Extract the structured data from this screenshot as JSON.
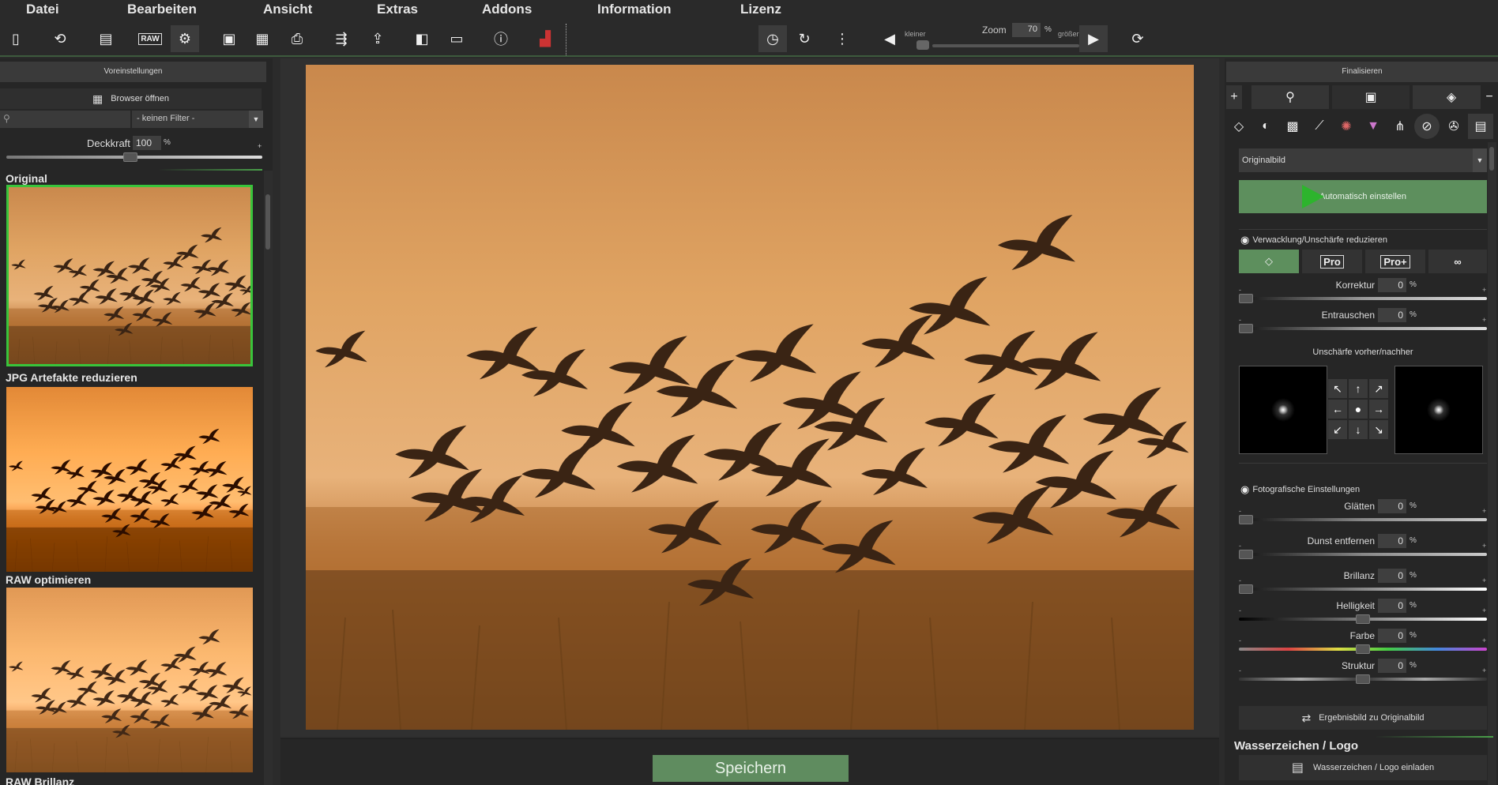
{
  "menu": [
    "Datei",
    "Bearbeiten",
    "Ansicht",
    "Extras",
    "Addons",
    "Information",
    "Lizenz"
  ],
  "toolbar": {
    "raw_label": "RAW",
    "zoom_label": "Zoom",
    "zoom_value": "70",
    "zoom_unit": "%",
    "zoom_smaller": "kleiner",
    "zoom_bigger": "größer",
    "zoom_level": 0.7
  },
  "left": {
    "header": "Voreinstellungen",
    "browser_button": "Browser öffnen",
    "filter_value": "- keinen Filter -",
    "opacity_label": "Deckkraft",
    "opacity_value": "100",
    "opacity_unit": "%",
    "opacity_plus": "+",
    "presets": [
      {
        "title": "Original",
        "selected": true
      },
      {
        "title": "JPG Artefakte reduzieren",
        "selected": false
      },
      {
        "title": "RAW optimieren",
        "selected": false
      },
      {
        "title": "RAW Brillanz",
        "selected": false
      }
    ]
  },
  "center": {
    "save_button": "Speichern"
  },
  "right": {
    "header": "Finalisieren",
    "tab_plus": "+",
    "tab_minus": "−",
    "source_select": "Originalbild",
    "auto_button": "Automatisch einstellen",
    "blur_section": "Verwacklung/Unschärfe reduzieren",
    "modes": [
      "",
      "Pro",
      "Pro+",
      ""
    ],
    "sliders_blur": [
      {
        "label": "Korrektur",
        "value": "0",
        "unit": "%"
      },
      {
        "label": "Entrauschen",
        "value": "0",
        "unit": "%"
      }
    ],
    "blur_preview_label": "Unschärfe vorher/nachher",
    "photo_section": "Fotografische Einstellungen",
    "sliders_photo": [
      {
        "label": "Glätten",
        "value": "0",
        "unit": "%"
      },
      {
        "label": "Dunst entfernen",
        "value": "0",
        "unit": "%"
      },
      {
        "label": "Brillanz",
        "value": "0",
        "unit": "%"
      },
      {
        "label": "Helligkeit",
        "value": "0",
        "unit": "%"
      },
      {
        "label": "Farbe",
        "value": "0",
        "unit": "%"
      },
      {
        "label": "Struktur",
        "value": "0",
        "unit": "%"
      }
    ],
    "slider_min": "-",
    "slider_max": "+",
    "result_button": "Ergebnisbild zu Originalbild",
    "watermark_header": "Wasserzeichen / Logo",
    "watermark_button": "Wasserzeichen / Logo einladen"
  },
  "colors": {
    "accent_green": "#5d8f5d",
    "selection_green": "#39c43b",
    "background": "#262626"
  }
}
